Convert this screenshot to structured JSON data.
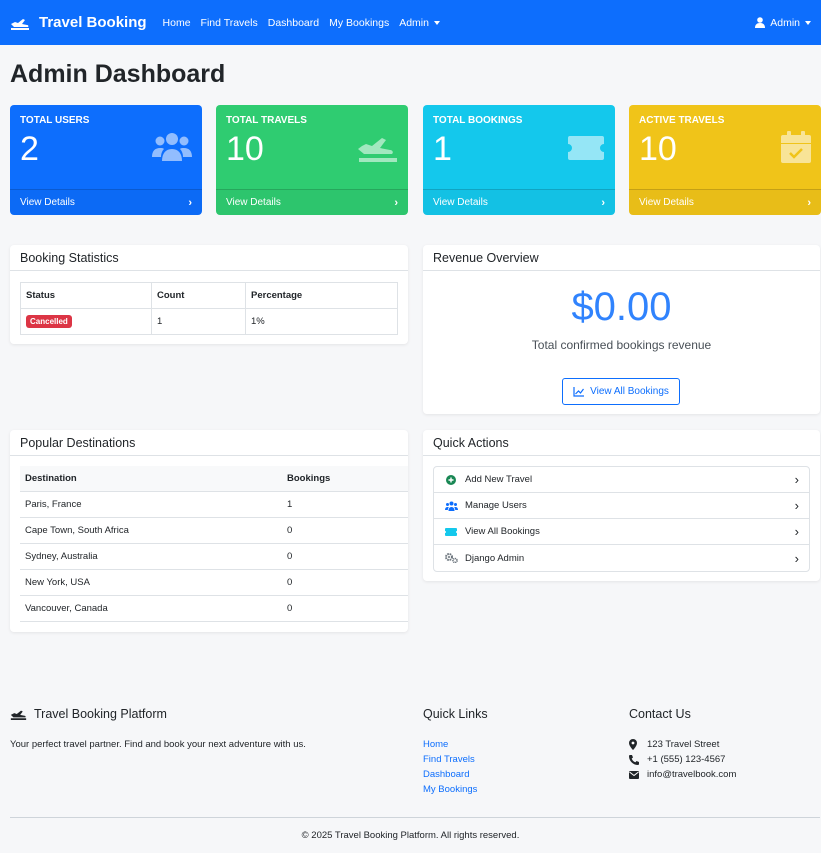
{
  "navbar": {
    "brand": "Travel Booking",
    "links": [
      "Home",
      "Find Travels",
      "Dashboard",
      "My Bookings"
    ],
    "admin_menu": "Admin",
    "user_menu": "Admin",
    "color": "#0d6efd"
  },
  "page_title": "Admin Dashboard",
  "stats": [
    {
      "label": "TOTAL USERS",
      "value": "2",
      "footer": "View Details",
      "color": "#0d6efd",
      "icon": "users-icon"
    },
    {
      "label": "TOTAL TRAVELS",
      "value": "10",
      "footer": "View Details",
      "color": "#2fcc71",
      "icon": "plane-icon"
    },
    {
      "label": "TOTAL BOOKINGS",
      "value": "1",
      "footer": "View Details",
      "color": "#14c8ec",
      "icon": "ticket-icon"
    },
    {
      "label": "ACTIVE TRAVELS",
      "value": "10",
      "footer": "View Details",
      "color": "#f0c419",
      "icon": "calendar-check-icon"
    }
  ],
  "booking_stats": {
    "title": "Booking Statistics",
    "headers": [
      "Status",
      "Count",
      "Percentage"
    ],
    "rows": [
      {
        "status": "Cancelled",
        "count": "1",
        "percentage": "1%"
      }
    ]
  },
  "revenue": {
    "title": "Revenue Overview",
    "amount": "$0.00",
    "subtitle": "Total confirmed bookings revenue",
    "button": "View All Bookings"
  },
  "destinations": {
    "title": "Popular Destinations",
    "headers": [
      "Destination",
      "Bookings"
    ],
    "rows": [
      {
        "name": "Paris, France",
        "bookings": "1"
      },
      {
        "name": "Cape Town, South Africa",
        "bookings": "0"
      },
      {
        "name": "Sydney, Australia",
        "bookings": "0"
      },
      {
        "name": "New York, USA",
        "bookings": "0"
      },
      {
        "name": "Vancouver, Canada",
        "bookings": "0"
      }
    ]
  },
  "quick_actions": {
    "title": "Quick Actions",
    "items": [
      {
        "label": "Add New Travel",
        "icon": "plus-circle-icon"
      },
      {
        "label": "Manage Users",
        "icon": "users-icon"
      },
      {
        "label": "View All Bookings",
        "icon": "ticket-icon"
      },
      {
        "label": "Django Admin",
        "icon": "cogs-icon"
      }
    ]
  },
  "footer": {
    "brand_title": "Travel Booking Platform",
    "tagline": "Your perfect travel partner. Find and book your next adventure with us.",
    "quick_links_title": "Quick Links",
    "quick_links": [
      "Home",
      "Find Travels",
      "Dashboard",
      "My Bookings"
    ],
    "contact_title": "Contact Us",
    "address": "123 Travel Street",
    "phone": "+1 (555) 123-4567",
    "email": "info@travelbook.com",
    "copyright": "© 2025 Travel Booking Platform. All rights reserved."
  }
}
